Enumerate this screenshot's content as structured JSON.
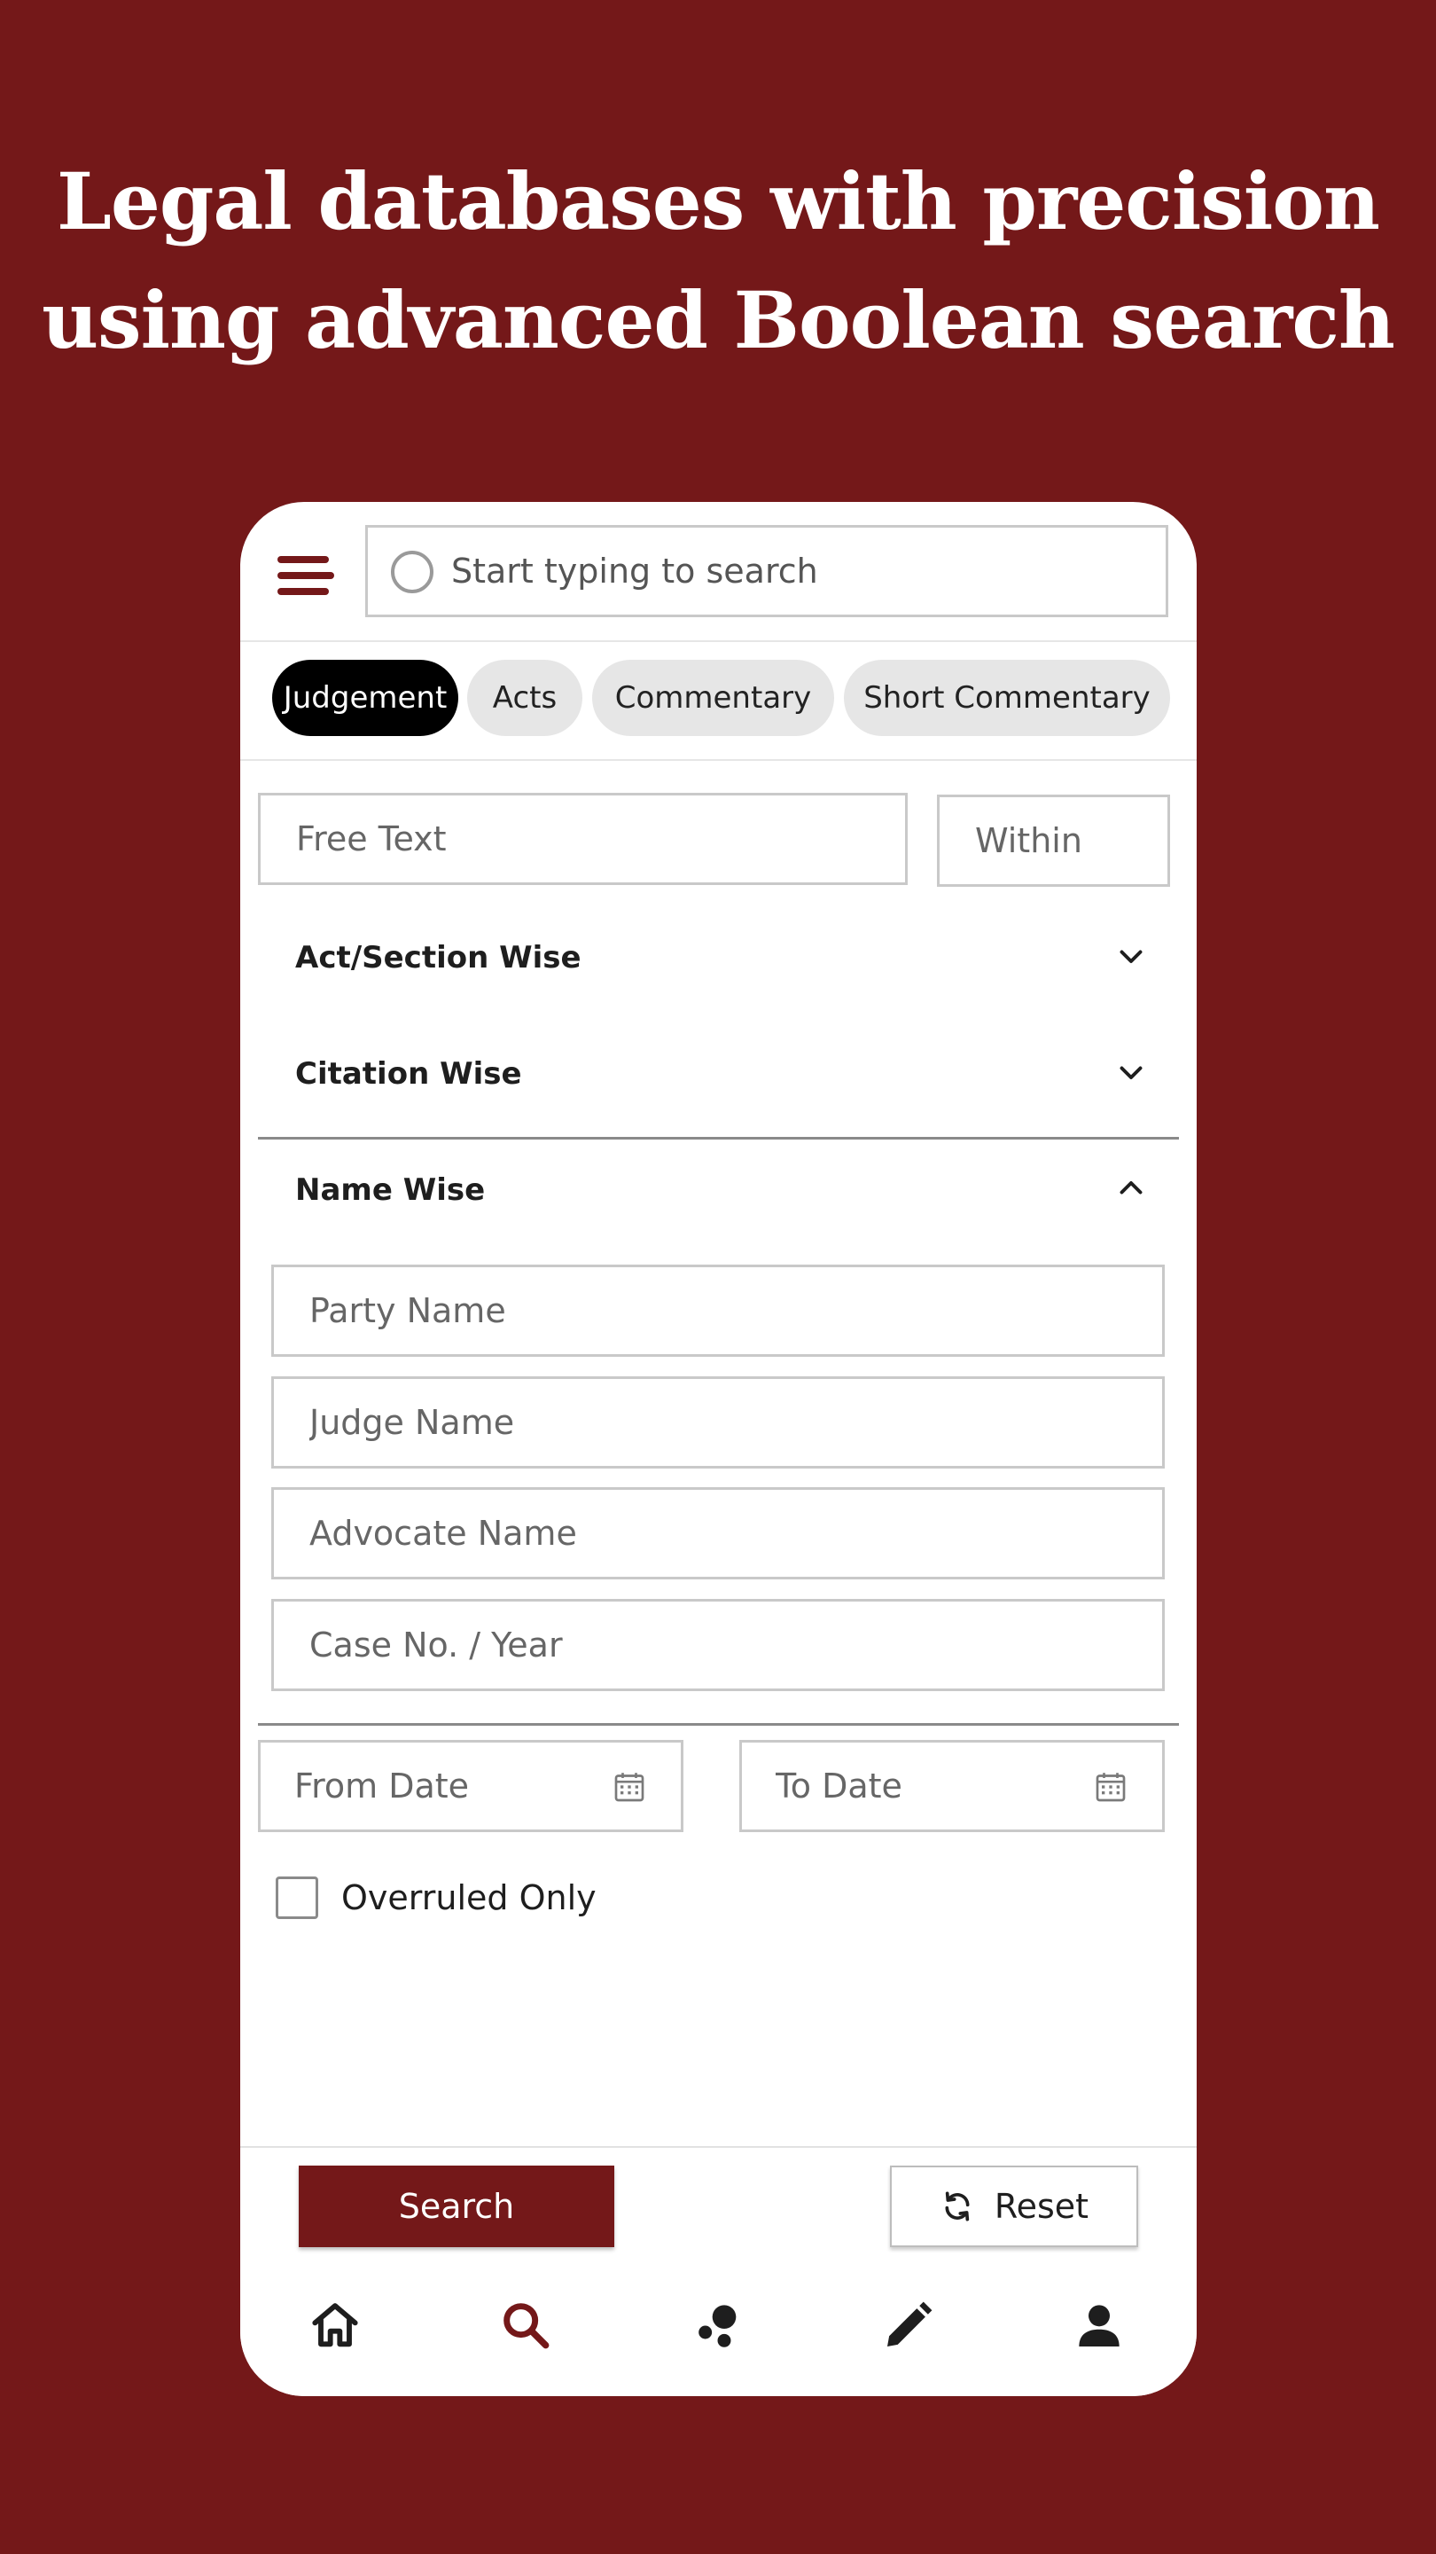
{
  "headline": {
    "line1": "Legal databases with precision",
    "line2": "using advanced Boolean search"
  },
  "colors": {
    "brand": "#741819",
    "tab_active": "#000000",
    "tab_inactive": "#e6e6e6"
  },
  "header": {
    "menu_icon": "hamburger-menu-icon",
    "search_placeholder": "Start typing to search",
    "search_icon": "search-icon"
  },
  "tabs": [
    {
      "label": "Judgement",
      "active": true
    },
    {
      "label": "Acts",
      "active": false
    },
    {
      "label": "Commentary",
      "active": false
    },
    {
      "label": "Short Commentary",
      "active": false
    }
  ],
  "form": {
    "free_text_placeholder": "Free Text",
    "within_placeholder": "Within",
    "sections": {
      "act_section": {
        "label": "Act/Section Wise",
        "expanded": false
      },
      "citation": {
        "label": "Citation Wise",
        "expanded": false
      },
      "name": {
        "label": "Name Wise",
        "expanded": true
      }
    },
    "name_fields": {
      "party": "Party Name",
      "judge": "Judge Name",
      "advocate": "Advocate Name",
      "case": "Case No. / Year"
    },
    "from_date_placeholder": "From Date",
    "to_date_placeholder": "To Date",
    "overruled_label": "Overruled Only",
    "overruled_checked": false
  },
  "actions": {
    "search_label": "Search",
    "reset_label": "Reset"
  },
  "bottom_nav": [
    {
      "icon": "home-icon"
    },
    {
      "icon": "search-icon",
      "active": true
    },
    {
      "icon": "network-icon"
    },
    {
      "icon": "pencil-icon"
    },
    {
      "icon": "person-icon"
    }
  ]
}
